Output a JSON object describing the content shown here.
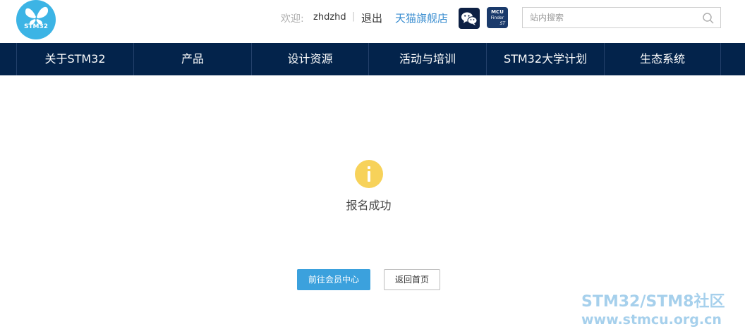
{
  "header": {
    "logo_text": "STM32",
    "welcome_label": "欢迎:",
    "username": "zhdzhd",
    "separator": "|",
    "logout_label": "退出",
    "tmall_label": "天猫旗舰店",
    "mcu_finder": {
      "line1": "MCU",
      "line2": "Finder",
      "brand": "ST"
    },
    "search": {
      "placeholder": "站内搜索",
      "value": ""
    }
  },
  "nav": {
    "items": [
      {
        "label": "关于STM32"
      },
      {
        "label": "产品"
      },
      {
        "label": "设计资源"
      },
      {
        "label": "活动与培训"
      },
      {
        "label": "STM32大学计划"
      },
      {
        "label": "生态系统"
      }
    ]
  },
  "main": {
    "icon": "info-icon",
    "message": "报名成功",
    "primary_button": "前往会员中心",
    "secondary_button": "返回首页"
  },
  "watermark": {
    "line1": "STM32/STM8社区",
    "line2": "www.stmcu.org.cn"
  },
  "colors": {
    "nav_bg": "#03234b",
    "logo_bg": "#3cb4e5",
    "primary_button": "#3ba1dd",
    "info_icon": "#f7d25a",
    "link": "#3b8ed0",
    "watermark": "#a6d0ec"
  }
}
